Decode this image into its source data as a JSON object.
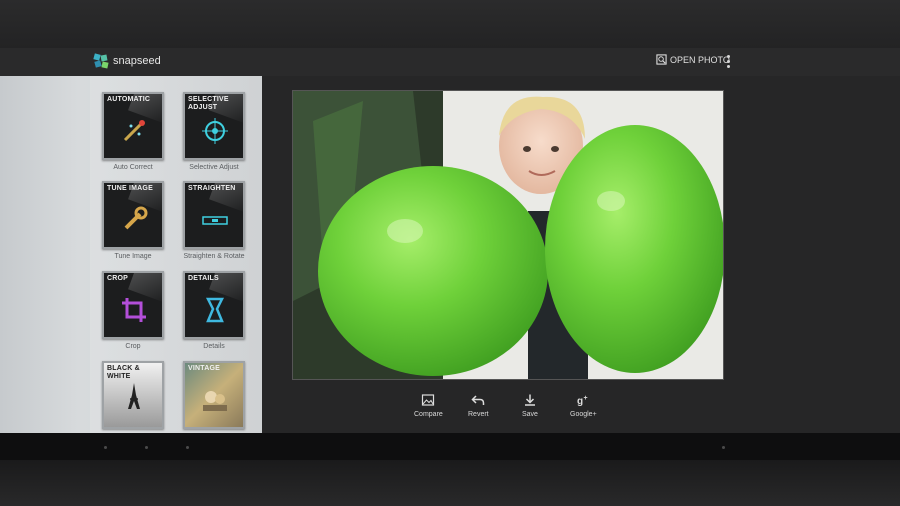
{
  "app": {
    "title": "snapseed"
  },
  "header": {
    "open_photo_label": "OPEN PHOTO"
  },
  "tools": [
    {
      "header": "AUTOMATIC",
      "label": "Auto Correct",
      "icon": "wand-icon"
    },
    {
      "header": "SELECTIVE ADJUST",
      "label": "Selective Adjust",
      "icon": "target-icon"
    },
    {
      "header": "TUNE IMAGE",
      "label": "Tune Image",
      "icon": "wrench-icon"
    },
    {
      "header": "STRAIGHTEN",
      "label": "Straighten & Rotate",
      "icon": "level-icon"
    },
    {
      "header": "CROP",
      "label": "Crop",
      "icon": "crop-icon"
    },
    {
      "header": "DETAILS",
      "label": "Details",
      "icon": "magnifier-icon"
    },
    {
      "header": "BLACK & WHITE",
      "label": "",
      "icon": "eiffel-icon"
    },
    {
      "header": "VINTAGE",
      "label": "",
      "icon": "vintage-photo-icon"
    }
  ],
  "actions": [
    {
      "label": "Compare",
      "icon": "image-icon"
    },
    {
      "label": "Revert",
      "icon": "undo-icon"
    },
    {
      "label": "Save",
      "icon": "download-icon"
    },
    {
      "label": "Google+",
      "icon": "google-plus-icon"
    }
  ],
  "colors": {
    "balloon": "#6fd13a",
    "sidebar": "#d3d6d8",
    "canvas": "#262627"
  }
}
